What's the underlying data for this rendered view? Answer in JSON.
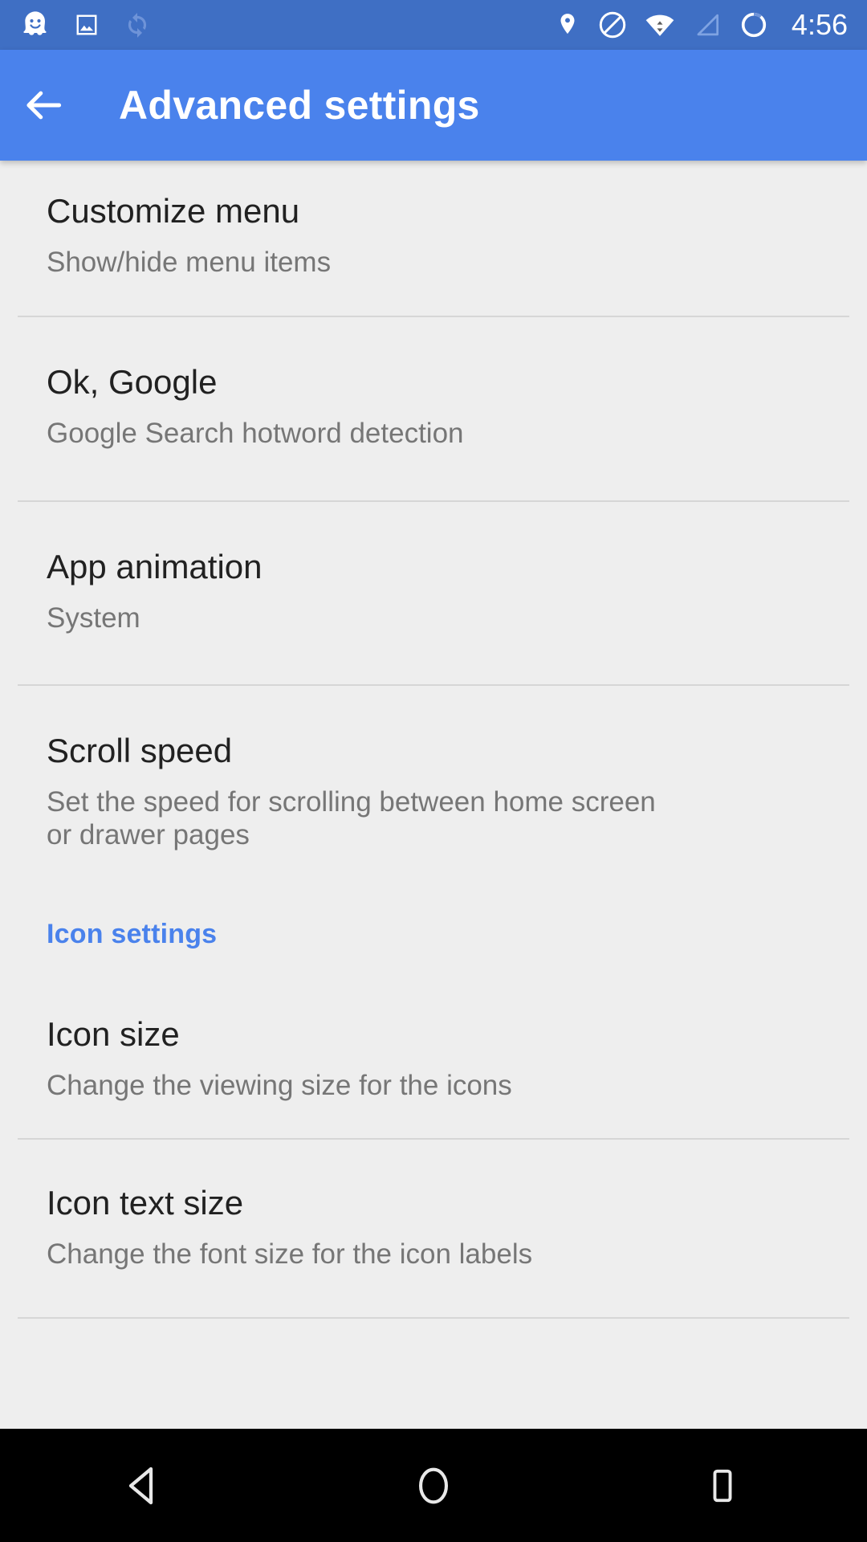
{
  "status_bar": {
    "background_color": "#3F6FC4",
    "time": "4:56",
    "left_icons": [
      {
        "name": "waze-ghost-icon"
      },
      {
        "name": "screenshot-image-icon"
      },
      {
        "name": "sync-icon"
      }
    ],
    "right_icons": [
      {
        "name": "location-pin-icon"
      },
      {
        "name": "do-not-disturb-icon"
      },
      {
        "name": "wifi-transfer-icon"
      },
      {
        "name": "cell-signal-icon"
      },
      {
        "name": "battery-circle-icon"
      }
    ]
  },
  "app_bar": {
    "background_color": "#4A82EC",
    "title": "Advanced settings",
    "back_icon": "arrow-back-icon"
  },
  "content": {
    "background_color": "#EEEEEE",
    "accent_color": "#4A82EC",
    "title_color": "#212121",
    "summary_color": "#767676",
    "divider_color": "#D6D6D6",
    "preferences": [
      {
        "title": "Customize menu",
        "summary": "Show/hide menu items"
      },
      {
        "title": "Ok, Google",
        "summary": "Google Search hotword detection"
      },
      {
        "title": "App animation",
        "summary": "System"
      },
      {
        "title": "Scroll speed",
        "summary": "Set the speed for scrolling between home screen or drawer pages"
      }
    ],
    "sections": [
      {
        "header": "Icon settings",
        "preferences": [
          {
            "title": "Icon size",
            "summary": "Change the viewing size for the icons"
          },
          {
            "title": "Icon text size",
            "summary": "Change the font size for the icon labels"
          }
        ]
      }
    ]
  },
  "nav_bar": {
    "background_color": "#000000",
    "buttons": [
      {
        "name": "back-nav-button",
        "icon": "triangle-back-icon"
      },
      {
        "name": "home-nav-button",
        "icon": "circle-home-icon"
      },
      {
        "name": "recents-nav-button",
        "icon": "square-recents-icon"
      }
    ]
  }
}
